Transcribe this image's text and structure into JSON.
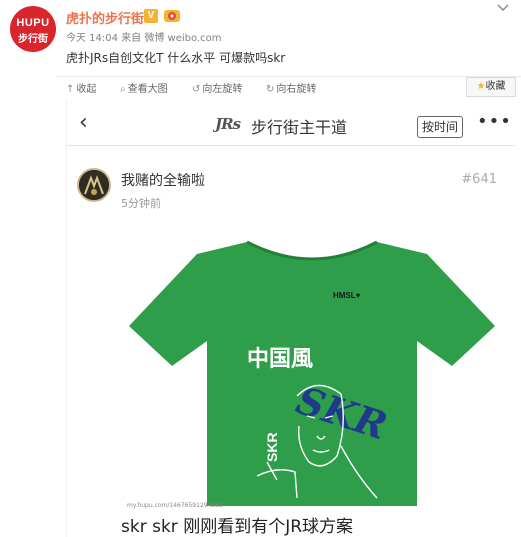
{
  "weibo": {
    "avatar_line1": "HUPU",
    "avatar_line2": "步行街",
    "username": "虎扑的步行街",
    "v_badge": "V",
    "meta": "今天 14:04 来自 微博 weibo.com",
    "post_text": "虎扑JRs自创文化T 什么水平 可爆款吗skr",
    "brand_color": "#d9252b",
    "name_color": "#eb7350"
  },
  "toolbar": {
    "collapse": "收起",
    "view_large": "查看大图",
    "rotate_left": "向左旋转",
    "rotate_right": "向右旋转",
    "favorite": "收藏"
  },
  "screenshot": {
    "nav": {
      "back": "‹",
      "logo": "JRs",
      "title": "步行街主干道",
      "sort_button": "按时间",
      "more": "•••"
    },
    "post": {
      "user_name": "我赌的全输啦",
      "time": "5分钟前",
      "floor": "#641",
      "shirt_color": "#2e9e4a",
      "shirt_texts": {
        "brand": "HMSL♥",
        "chinese": "中国風",
        "big": "SKR",
        "vertical": "SKR"
      },
      "watermark": "my.hupu.com/14676591294563",
      "caption": "skr skr 刚刚看到有个JR球方案"
    }
  }
}
